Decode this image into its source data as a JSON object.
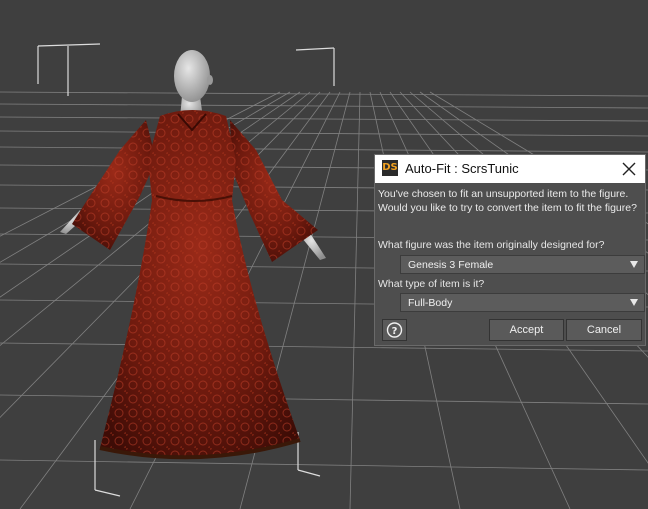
{
  "dialog": {
    "title": "Auto-Fit : ScrsTunic",
    "app_logo": "DS",
    "message_line1": "You've chosen to fit an unsupported item to the figure.",
    "message_line2": "Would you like to try to convert the item to fit the figure?",
    "figure_label": "What figure was the item originally designed for?",
    "figure_value": "Genesis 3 Female",
    "type_label": "What type of item is it?",
    "type_value": "Full-Body",
    "accept_label": "Accept",
    "cancel_label": "Cancel",
    "help_icon": "help-icon",
    "close_icon": "close-icon"
  },
  "colors": {
    "viewport_bg": "#3f3f3f",
    "grid_line": "#8a8a8a",
    "dialog_bg": "#4e4e4e",
    "robe": "#7a1c10",
    "skin": "#c8c8c8"
  }
}
